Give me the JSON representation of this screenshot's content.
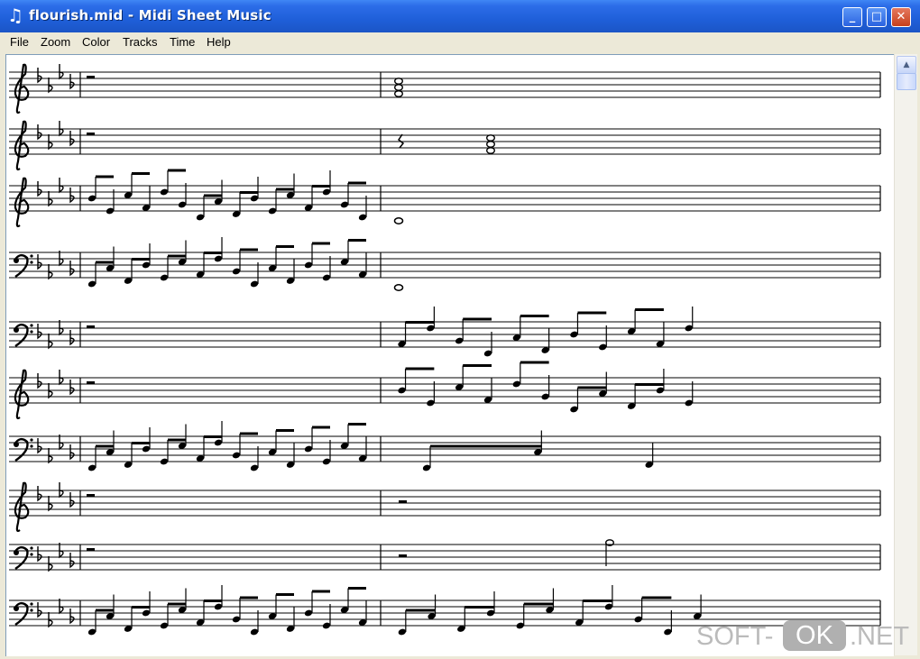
{
  "window": {
    "title": "flourish.mid - Midi Sheet Music",
    "app_icon": "music-note-icon",
    "controls": {
      "minimize": "_",
      "maximize": "□",
      "close": "✕"
    }
  },
  "menu": [
    "File",
    "Zoom",
    "Color",
    "Tracks",
    "Time",
    "Help"
  ],
  "staffs": [
    {
      "clef": "treble"
    },
    {
      "clef": "treble"
    },
    {
      "clef": "treble"
    },
    {
      "clef": "bass"
    },
    {
      "clef": "bass"
    },
    {
      "clef": "treble"
    },
    {
      "clef": "bass"
    },
    {
      "clef": "treble"
    },
    {
      "clef": "bass"
    },
    {
      "clef": "bass"
    }
  ],
  "key_signature": "A-flat major (4 flats)",
  "watermark": {
    "left": "SOFT-",
    "box": "OK",
    "right": ".NET"
  }
}
